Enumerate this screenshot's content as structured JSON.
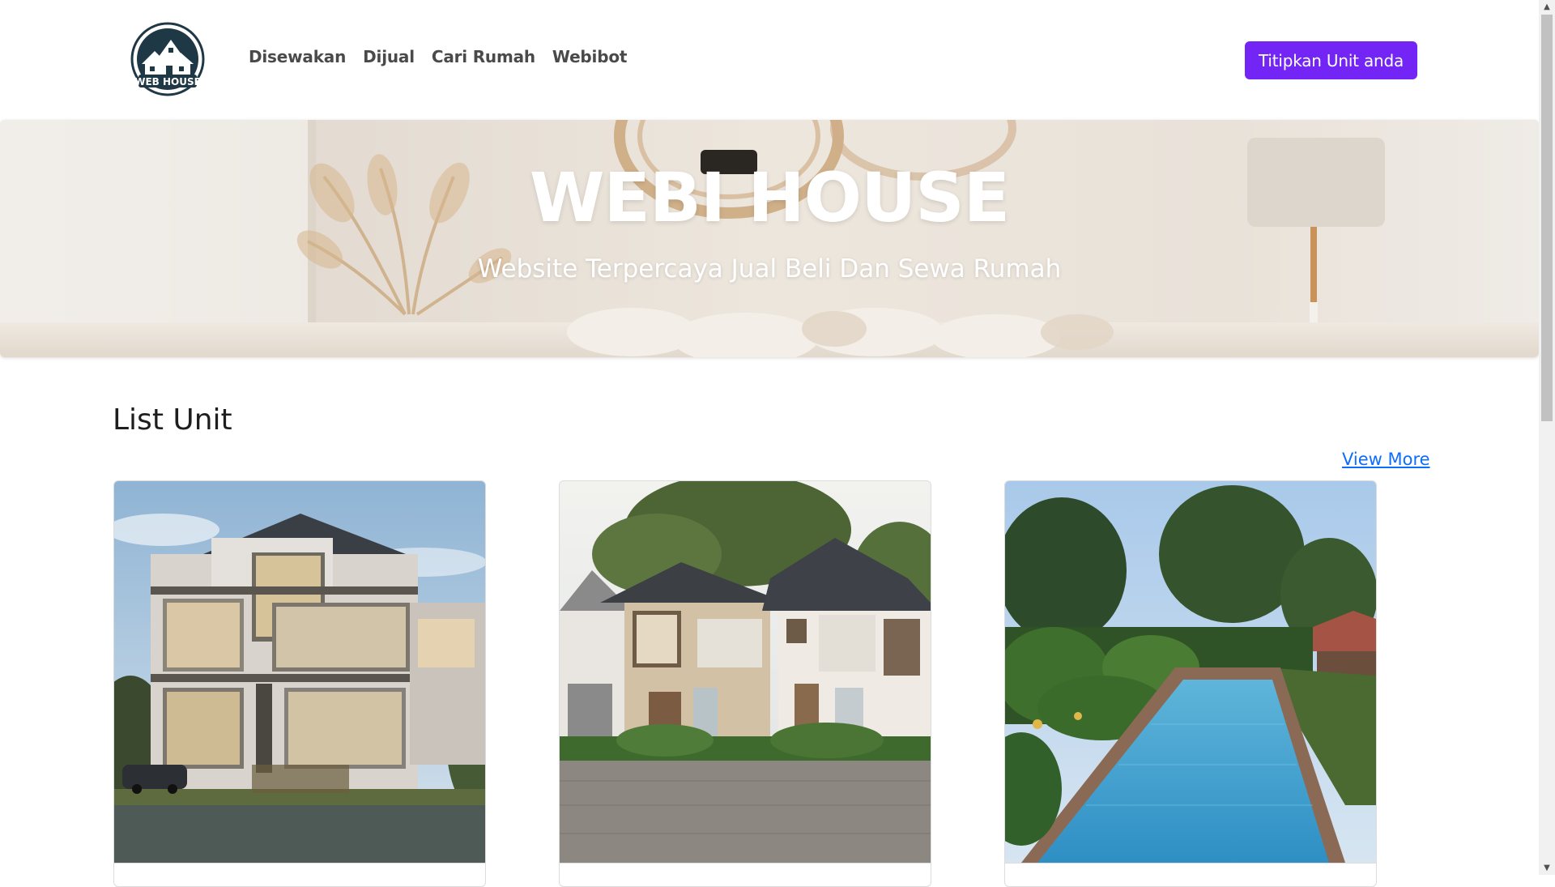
{
  "brand": {
    "logo_text": "WEB HOUSE"
  },
  "nav": {
    "items": [
      {
        "label": "Disewakan"
      },
      {
        "label": "Dijual"
      },
      {
        "label": "Cari Rumah"
      },
      {
        "label": "Webibot"
      }
    ]
  },
  "cta": {
    "label": "Titipkan Unit anda"
  },
  "hero": {
    "title": "WEBI HOUSE",
    "subtitle": "Website Terpercaya Jual Beli Dan Sewa Rumah"
  },
  "list": {
    "title": "List Unit",
    "view_more": "View More"
  },
  "colors": {
    "accent": "#7225f5",
    "link": "#0d6efd"
  }
}
